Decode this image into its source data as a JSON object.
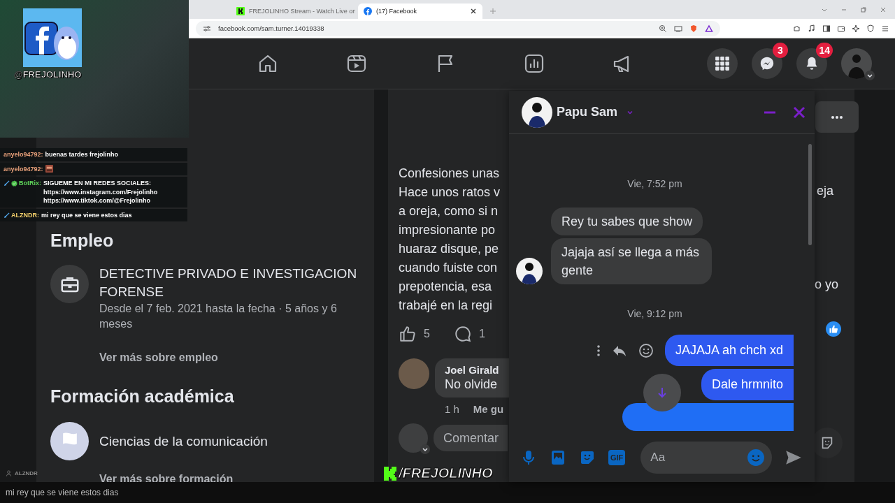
{
  "browser": {
    "tabs": [
      {
        "title": "FREJOLINHO Stream - Watch Live on",
        "selected": false
      },
      {
        "title": "(17) Facebook",
        "selected": true
      }
    ],
    "url": "facebook.com/sam.turner.14019338"
  },
  "nav": {
    "messenger_badge": "3",
    "notifications_badge": "14"
  },
  "profile": {
    "employment": {
      "heading": "Empleo",
      "title": "DETECTIVE PRIVADO E INVESTIGACION FORENSE",
      "dates": "Desde el 7 feb. 2021 hasta la fecha · 5 años y 6 meses",
      "more_link": "Ver más sobre empleo"
    },
    "education": {
      "heading": "Formación académica",
      "school": "Ciencias de la comunicación",
      "more_link": "Ver más sobre formación"
    }
  },
  "post": {
    "text_lines": [
      "Confesiones unas",
      "Hace unos ratos v",
      "a oreja, como si n",
      "impresionante po",
      "huaraz disque, pe",
      "cuando fuiste con",
      "prepotencia, esa",
      "trabajé en la regi"
    ],
    "right_fragments": [
      "eja",
      "o yo"
    ],
    "likes": "5",
    "comments": "1",
    "comment": {
      "author": "Joel Girald",
      "text": "No olvide",
      "time": "1 h",
      "like_link": "Me gu"
    },
    "comment_placeholder": "Comentar"
  },
  "messenger": {
    "contact": "Papu Sam",
    "messages": [
      {
        "kind": "timestamp",
        "text": "Vie, 7:52 pm"
      },
      {
        "kind": "incoming",
        "text": "Rey tu sabes que show",
        "avatar": false
      },
      {
        "kind": "incoming",
        "text": "Jajaja así se llega a más gente",
        "avatar": true
      },
      {
        "kind": "timestamp",
        "text": "Vie, 9:12 pm"
      },
      {
        "kind": "outgoing",
        "text": "JAJAJA ah chch xd",
        "actions": true
      },
      {
        "kind": "outgoing",
        "text": "Dale hrmnito",
        "actions": false
      },
      {
        "kind": "clipped"
      }
    ],
    "composer": {
      "gif_label": "GIF",
      "placeholder": "Aa"
    }
  },
  "stream": {
    "handle": "@FREJOLINHO",
    "chat": [
      {
        "user": "anyelo94792:",
        "color": "#e8a07a",
        "kind": "text",
        "text": "buenas tardes frejolinho",
        "moderator": false,
        "bot": false
      },
      {
        "user": "anyelo94792:",
        "color": "#e8a07a",
        "kind": "emote",
        "moderator": false,
        "bot": false
      },
      {
        "user": "BotRix:",
        "color": "#5fd65a",
        "kind": "text",
        "text": "SIGUEME EN MI REDES SOCIALES: https://www.instagram.com/Frejolinho https://www.tiktok.com/@Frejolinho",
        "moderator": true,
        "bot": true
      },
      {
        "user": "ALZNDR:",
        "color": "#f2cf6b",
        "kind": "text",
        "text": "mi rey que se viene estos dias",
        "moderator": true,
        "bot": false
      }
    ],
    "last_chatter": "ALZNDR",
    "caption": "mi rey que se viene estos dias",
    "brand_tag": "/FREJOLINHO"
  }
}
